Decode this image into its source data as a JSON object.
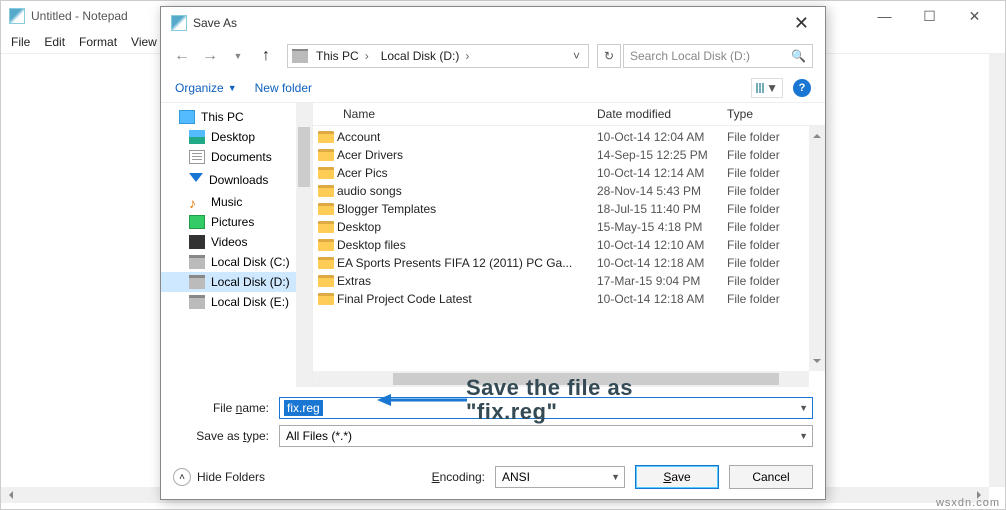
{
  "notepad": {
    "title": "Untitled - Notepad",
    "menu": [
      "File",
      "Edit",
      "Format",
      "View"
    ]
  },
  "dialog": {
    "title": "Save As",
    "breadcrumb": [
      "This PC",
      "Local Disk (D:)"
    ],
    "search_placeholder": "Search Local Disk (D:)",
    "toolbar": {
      "organize": "Organize",
      "new_folder": "New folder"
    },
    "tree": {
      "root": "This PC",
      "items": [
        {
          "label": "Desktop",
          "icon": "desktop"
        },
        {
          "label": "Documents",
          "icon": "doc"
        },
        {
          "label": "Downloads",
          "icon": "dl"
        },
        {
          "label": "Music",
          "icon": "music"
        },
        {
          "label": "Pictures",
          "icon": "pic"
        },
        {
          "label": "Videos",
          "icon": "vid"
        },
        {
          "label": "Local Disk (C:)",
          "icon": "drive"
        },
        {
          "label": "Local Disk (D:)",
          "icon": "drive",
          "selected": true
        },
        {
          "label": "Local Disk (E:)",
          "icon": "drive"
        }
      ]
    },
    "columns": {
      "name": "Name",
      "date": "Date modified",
      "type": "Type"
    },
    "files": [
      {
        "name": "Account",
        "date": "10-Oct-14 12:04 AM",
        "type": "File folder"
      },
      {
        "name": "Acer Drivers",
        "date": "14-Sep-15 12:25 PM",
        "type": "File folder"
      },
      {
        "name": "Acer Pics",
        "date": "10-Oct-14 12:14 AM",
        "type": "File folder"
      },
      {
        "name": "audio songs",
        "date": "28-Nov-14 5:43 PM",
        "type": "File folder"
      },
      {
        "name": "Blogger Templates",
        "date": "18-Jul-15 11:40 PM",
        "type": "File folder"
      },
      {
        "name": "Desktop",
        "date": "15-May-15 4:18 PM",
        "type": "File folder"
      },
      {
        "name": "Desktop files",
        "date": "10-Oct-14 12:10 AM",
        "type": "File folder"
      },
      {
        "name": "EA Sports Presents FIFA 12 (2011) PC Ga...",
        "date": "10-Oct-14 12:18 AM",
        "type": "File folder"
      },
      {
        "name": "Extras",
        "date": "17-Mar-15 9:04 PM",
        "type": "File folder"
      },
      {
        "name": "Final Project Code Latest",
        "date": "10-Oct-14 12:18 AM",
        "type": "File folder"
      }
    ],
    "filename_label": "File name:",
    "filename_value": "fix.reg",
    "saveastype_label": "Save as type:",
    "saveastype_value": "All Files  (*.*)",
    "hide_folders": "Hide Folders",
    "encoding_label": "Encoding:",
    "encoding_value": "ANSI",
    "save_btn": "Save",
    "cancel_btn": "Cancel"
  },
  "annotation": "Save the file as\n\"fix.reg\"",
  "watermark": "wsxdn.com"
}
